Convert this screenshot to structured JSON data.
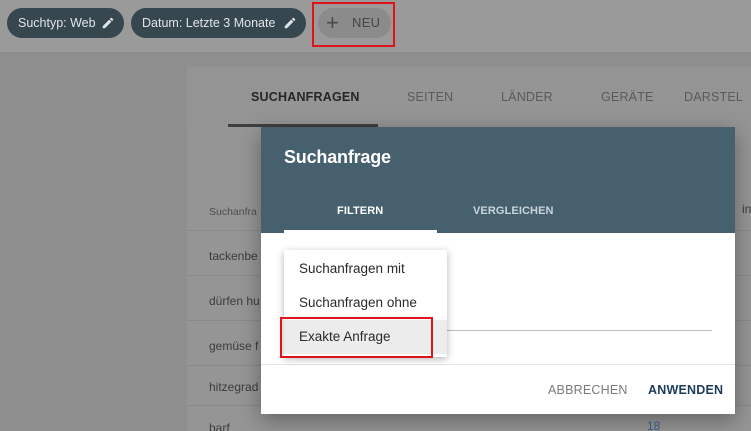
{
  "filters": {
    "search_type": "Suchtyp: Web",
    "date": "Datum: Letzte 3 Monate",
    "new_label": "NEU",
    "new_icon": "plus-icon",
    "edit_icon": "pencil-icon"
  },
  "report": {
    "tabs": [
      "SUCHANFRAGEN",
      "SEITEN",
      "LÄNDER",
      "GERÄTE",
      "DARSTEL"
    ],
    "column_header": "Suchanfra",
    "column_header_right": "in",
    "rows": [
      "tackenbe",
      "dürfen hu",
      "gemüse f",
      "hitzegrad",
      "barf"
    ],
    "last_row_value": "18"
  },
  "dialog": {
    "title": "Suchanfrage",
    "tabs": [
      "FILTERN",
      "VERGLEICHEN"
    ],
    "cancel_label": "ABBRECHEN",
    "apply_label": "ANWENDEN"
  },
  "menu": {
    "options": [
      "Suchanfragen mit",
      "Suchanfragen ohne",
      "Exakte Anfrage"
    ],
    "selected": "Exakte Anfrage"
  },
  "colors": {
    "highlight": "#e0121c",
    "dialog_header": "#46606e",
    "chip": "#36474f"
  }
}
